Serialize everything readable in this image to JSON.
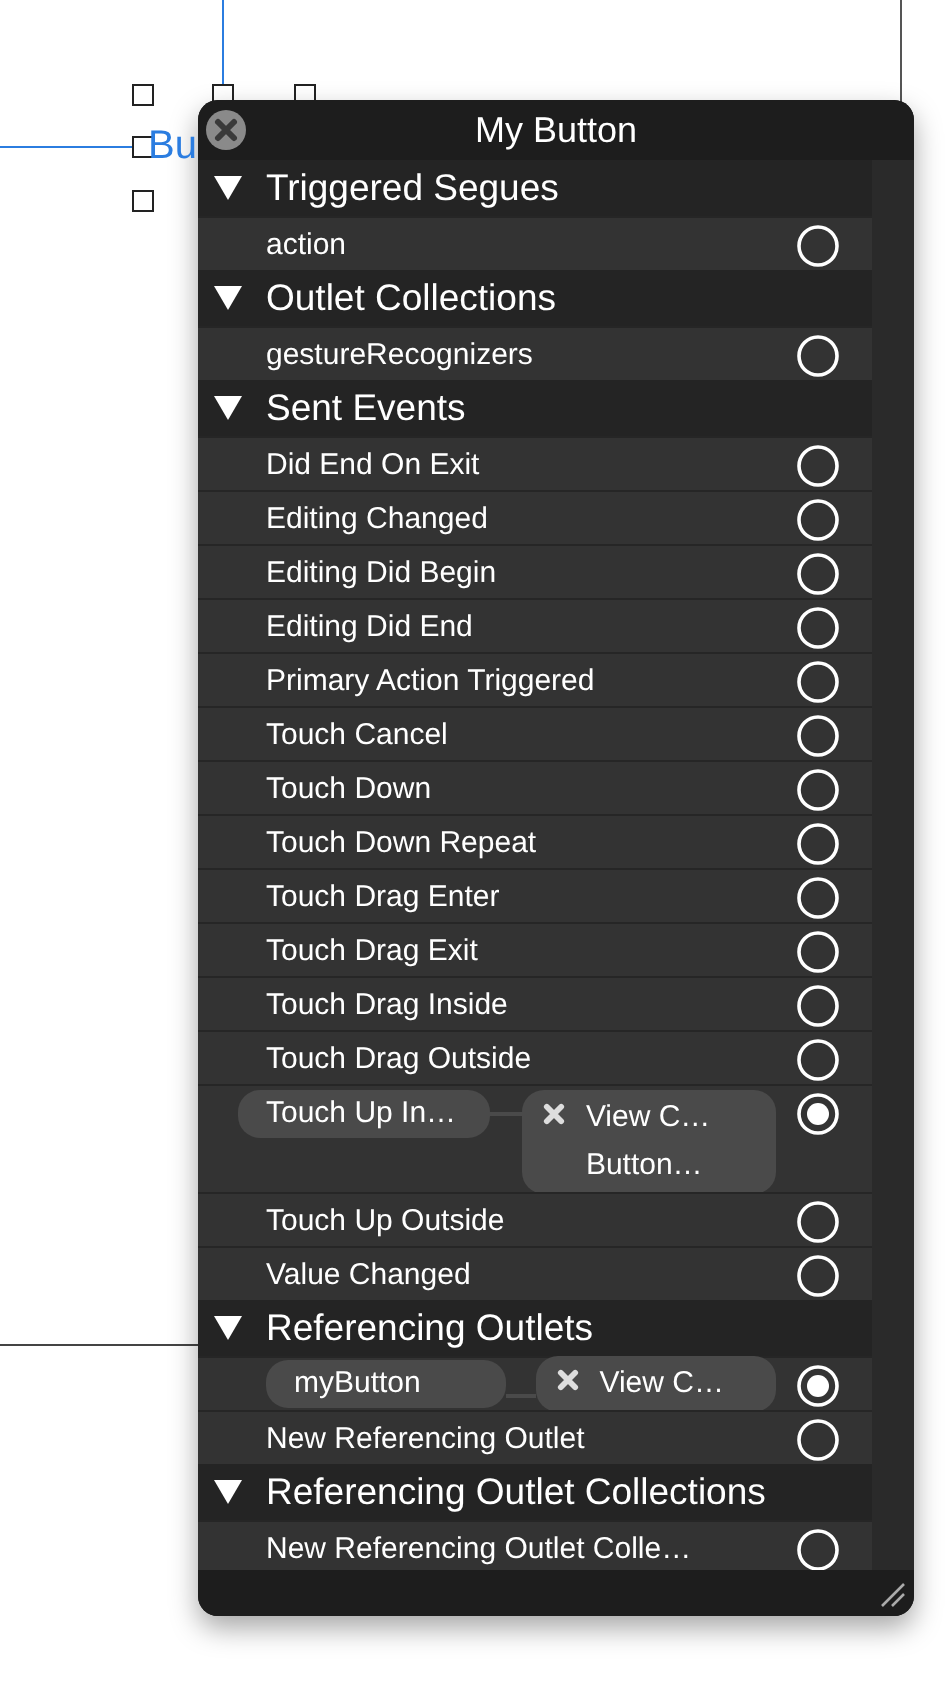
{
  "canvas": {
    "button_label": "Bu"
  },
  "panel": {
    "title": "My Button",
    "sections": [
      {
        "title": "Triggered Segues",
        "expanded": true,
        "rows": [
          {
            "kind": "plain",
            "label": "action",
            "connected": false
          }
        ]
      },
      {
        "title": "Outlet Collections",
        "expanded": true,
        "rows": [
          {
            "kind": "plain",
            "label": "gestureRecognizers",
            "connected": false
          }
        ]
      },
      {
        "title": "Sent Events",
        "expanded": true,
        "rows": [
          {
            "kind": "plain",
            "label": "Did End On Exit",
            "connected": false
          },
          {
            "kind": "plain",
            "label": "Editing Changed",
            "connected": false
          },
          {
            "kind": "plain",
            "label": "Editing Did Begin",
            "connected": false
          },
          {
            "kind": "plain",
            "label": "Editing Did End",
            "connected": false
          },
          {
            "kind": "plain",
            "label": "Primary Action Triggered",
            "connected": false
          },
          {
            "kind": "plain",
            "label": "Touch Cancel",
            "connected": false
          },
          {
            "kind": "plain",
            "label": "Touch Down",
            "connected": false
          },
          {
            "kind": "plain",
            "label": "Touch Down Repeat",
            "connected": false
          },
          {
            "kind": "plain",
            "label": "Touch Drag Enter",
            "connected": false
          },
          {
            "kind": "plain",
            "label": "Touch Drag Exit",
            "connected": false
          },
          {
            "kind": "plain",
            "label": "Touch Drag Inside",
            "connected": false
          },
          {
            "kind": "plain",
            "label": "Touch Drag Outside",
            "connected": false
          },
          {
            "kind": "connection",
            "label": "Touch Up In…",
            "connected": true,
            "target": [
              "View C…",
              "Button…"
            ]
          },
          {
            "kind": "plain",
            "label": "Touch Up Outside",
            "connected": false
          },
          {
            "kind": "plain",
            "label": "Value Changed",
            "connected": false
          }
        ]
      },
      {
        "title": "Referencing Outlets",
        "expanded": true,
        "rows": [
          {
            "kind": "connection",
            "label": "myButton",
            "connected": true,
            "target": [
              "View C…"
            ]
          },
          {
            "kind": "plain",
            "label": "New Referencing Outlet",
            "connected": false
          }
        ]
      },
      {
        "title": "Referencing Outlet Collections",
        "expanded": true,
        "rows": [
          {
            "kind": "plain",
            "label": "New Referencing Outlet Colle…",
            "connected": false
          }
        ]
      }
    ]
  }
}
